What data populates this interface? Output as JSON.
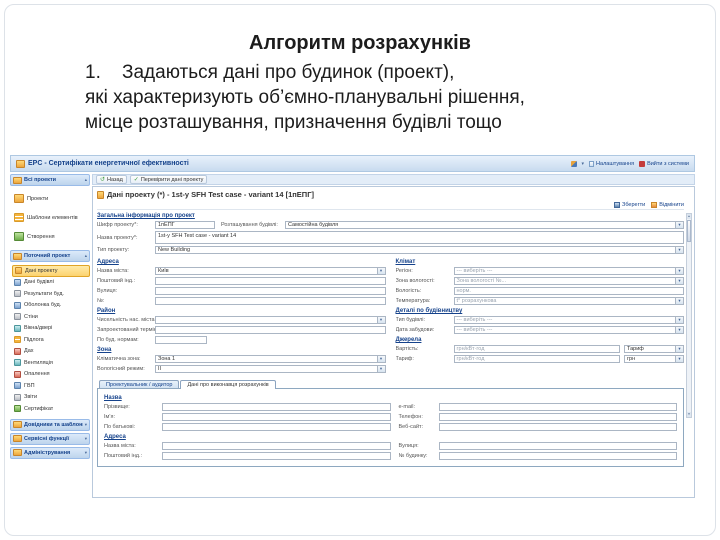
{
  "slide": {
    "title": "Алгоритм розрахунків",
    "item_number": "1.",
    "body_lines": [
      "Задаються дані про будинок (проект),",
      "які характеризують об’ємно-планувальні рішення,",
      "місце розташування, призначення будівлі тощо"
    ]
  },
  "app": {
    "titlebar": {
      "title": "EPC - Сертифікати енергетичної ефективності",
      "caret": "▾",
      "settings": "Налаштування",
      "logout": "Вийти з системи"
    },
    "toolbar": {
      "back": "Назад",
      "check": "Перевірити дані проекту",
      "refresh_glyph": "↺",
      "check_glyph": "✓"
    },
    "sidebar": {
      "sections": [
        {
          "label": "Всі проекти",
          "arrow": "▴"
        },
        {
          "label": "Поточний проект",
          "arrow": "▴"
        },
        {
          "label": "Довідники та шаблони",
          "arrow": "▾"
        },
        {
          "label": "Сервісні функції",
          "arrow": "▾"
        },
        {
          "label": "Адміністрування",
          "arrow": "▾"
        }
      ],
      "all_projects_items": [
        "Проекти",
        "Шаблони елементів",
        "Створення"
      ],
      "current_project_items": [
        "Дані проекту",
        "Дані будівлі",
        "Результати буд.",
        "Оболонка буд.",
        "Стіни",
        "Вікна/двері",
        "Підлога",
        "Дах",
        "Вентиляція",
        "Опалення",
        "ГВП",
        "Звіти",
        "Сертифікат"
      ]
    },
    "content": {
      "title": "Дані проекту (*) - 1st-y SFH Test case - variant 14 [1пЕПГ]",
      "save": "Зберегти",
      "cancel": "Відмінити"
    },
    "form": {
      "general": {
        "header": "Загальна інформація про проект",
        "code_label": "Шифр проекту*:",
        "code_value": "1пЕПГ",
        "location_label": "Розташування будівлі:",
        "location_value": "Самостійна будівля",
        "name_label": "Назва проекту*:",
        "name_value": "1st-y SFH Test case - variant 14",
        "type_label": "Тип проекту:",
        "type_value": "New Building"
      },
      "address": {
        "header": "Адреса",
        "city_label": "Назва міста:",
        "city_value": "Київ",
        "postal_label": "Поштовий інд.:",
        "street_label": "Вулиця:",
        "number_label": "№:"
      },
      "climate": {
        "header": "Клімат",
        "region_label": "Регіон:",
        "region_value": "--- виберіть ---",
        "zone_label": "Зона вологості:",
        "zone_value": "Зона вологості №...",
        "humidity_label": "Вологість:",
        "humidity_value": "норм.",
        "temp_label": "Температура:",
        "temp_value": "t° розрахункова"
      },
      "district": {
        "header": "Район",
        "population_label": "Чисельність нас. міста:",
        "term_label": "Запроектований термін:",
        "norms_label": "По буд. нормам:"
      },
      "construction": {
        "header": "Деталі по будівництву",
        "func_label": "Тип будівлі:",
        "func_value": "--- виберіть ---",
        "date_label": "Дата забудови:",
        "date_value": "--- виберіть ---"
      },
      "zone": {
        "header": "Зона",
        "climate_zone_label": "Кліматична зона:",
        "climate_zone_value": "Зона 1",
        "humidity_mode_label": "Вологісний режим:",
        "humidity_mode_value": "ІІ"
      },
      "sources": {
        "header": "Джерела",
        "cost_label": "Вартість:",
        "cost_value": "грн/кВт·год",
        "tariff_value": "Тариф",
        "unit_label": "Тариф:",
        "unit_value": "грн/кВт·год",
        "unit_select": "грн"
      }
    },
    "tabs": [
      "Проектувальник / аудитор",
      "Дані про виконавця розрахунків"
    ],
    "bottom": {
      "name_header": "Назва",
      "surname_label": "Прізвище:",
      "firstname_label": "Ім’я:",
      "patronymic_label": "По батькові:",
      "email_label": "e-mail:",
      "phone_label": "Телефон:",
      "website_label": "Веб-сайт:",
      "address_header": "Адреса",
      "city_label": "Назва міста:",
      "postal_label": "Поштовий інд.:",
      "street_label": "Вулиця:",
      "house_label": "№ будинку:"
    }
  }
}
